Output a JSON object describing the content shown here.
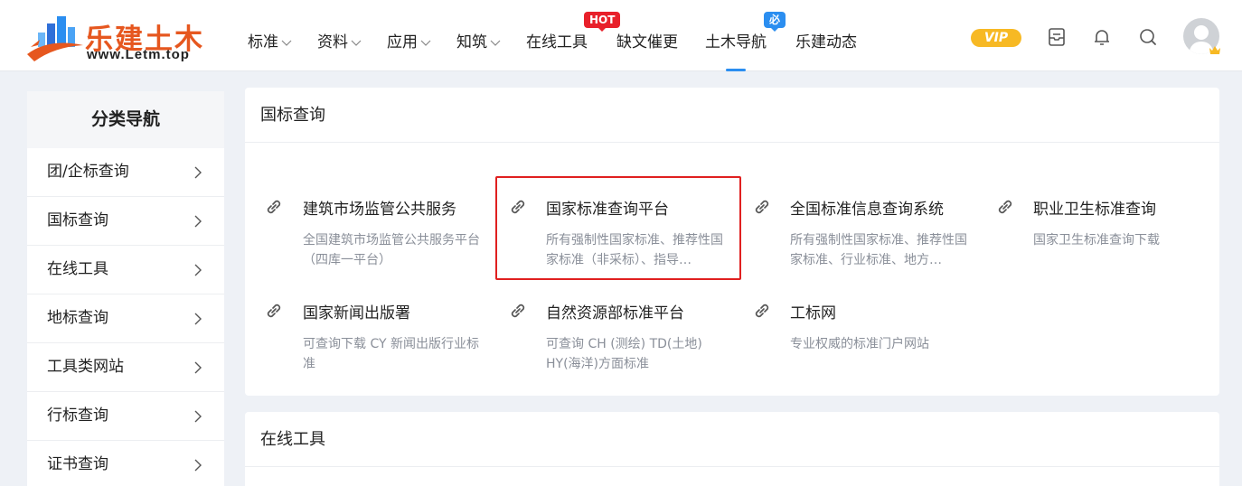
{
  "logo": {
    "title": "乐建土木",
    "url": "www.Letm.top"
  },
  "nav": {
    "items": [
      {
        "label": "标准",
        "dropdown": true
      },
      {
        "label": "资料",
        "dropdown": true
      },
      {
        "label": "应用",
        "dropdown": true
      },
      {
        "label": "知筑",
        "dropdown": true
      },
      {
        "label": "在线工具",
        "dropdown": false,
        "badge": "HOT"
      },
      {
        "label": "缺文催更",
        "dropdown": false
      },
      {
        "label": "土木导航",
        "dropdown": false,
        "badge": "必备",
        "active": true
      },
      {
        "label": "乐建动态",
        "dropdown": false
      }
    ],
    "badge_hot": "HOT",
    "badge_must": "必备"
  },
  "header": {
    "vip_label": "VIP",
    "icons": [
      "document-icon",
      "bell-icon",
      "search-icon",
      "avatar"
    ]
  },
  "colors": {
    "brand_orange": "#e6571f",
    "accent_blue": "#2b8ef0",
    "hot_red": "#e8202a",
    "vip_gold": "#f7b924",
    "highlight_red": "#e02020"
  },
  "sidebar": {
    "title": "分类导航",
    "items": [
      {
        "label": "团/企标查询"
      },
      {
        "label": "国标查询"
      },
      {
        "label": "在线工具"
      },
      {
        "label": "地标查询"
      },
      {
        "label": "工具类网站"
      },
      {
        "label": "行标查询"
      },
      {
        "label": "证书查询"
      }
    ]
  },
  "sections": [
    {
      "title": "国标查询",
      "sites": [
        {
          "name": "建筑市场监管公共服务",
          "desc": "全国建筑市场监管公共服务平台（四库一平台）"
        },
        {
          "name": "国家标准查询平台",
          "desc": "所有强制性国家标准、推荐性国家标准（非采标）、指导…",
          "highlighted": true
        },
        {
          "name": "全国标准信息查询系统",
          "desc": "所有强制性国家标准、推荐性国家标准、行业标准、地方…"
        },
        {
          "name": "职业卫生标准查询",
          "desc": "国家卫生标准查询下载"
        },
        {
          "name": "国家新闻出版署",
          "desc": "可查询下载 CY 新闻出版行业标准"
        },
        {
          "name": "自然资源部标准平台",
          "desc": "可查询 CH (测绘) TD(土地) HY(海洋)方面标准"
        },
        {
          "name": "工标网",
          "desc": "专业权威的标准门户网站"
        }
      ]
    },
    {
      "title": "在线工具",
      "sites": []
    }
  ]
}
